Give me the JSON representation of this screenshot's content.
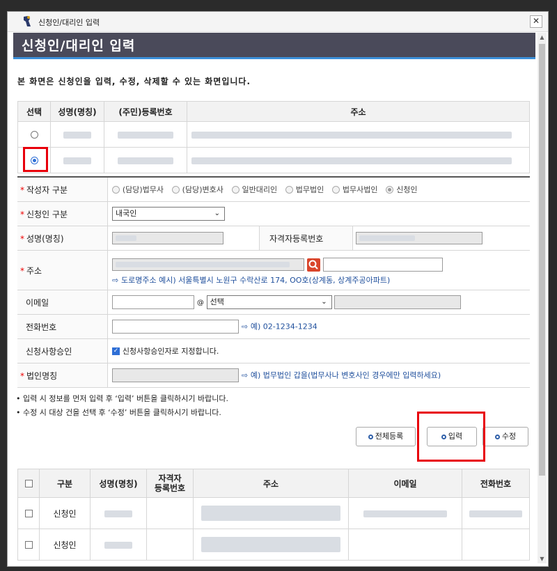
{
  "window": {
    "title": "신청인/대리인 입력"
  },
  "header": {
    "title": "신청인/대리인 입력"
  },
  "description": "본 화면은 신청인을 입력, 수정, 삭제할 수 있는 화면입니다.",
  "top_table": {
    "headers": [
      "선택",
      "성명(명칭)",
      "(주민)등록번호",
      "주소"
    ],
    "selected_row": 1
  },
  "form": {
    "writer_type": {
      "label": "작성자 구분",
      "options": [
        "(담당)법무사",
        "(담당)변호사",
        "일반대리인",
        "법무법인",
        "법무사법인",
        "신청인"
      ],
      "selected": "신청인"
    },
    "applicant_type": {
      "label": "신청인 구분",
      "value": "내국인"
    },
    "name": {
      "label": "성명(명칭)"
    },
    "qualification_no": {
      "label": "자격자등록번호"
    },
    "address": {
      "label": "주소",
      "hint": "도로명주소 예시) 서울특별시 노원구 수락산로 174, OO호(상계동, 상계주공아파트)"
    },
    "email": {
      "label": "이메일",
      "at": "@",
      "domain_select": "선택"
    },
    "phone": {
      "label": "전화번호",
      "hint": "예) 02-1234-1234"
    },
    "approver": {
      "label": "신청사항승인",
      "checkbox_label": "신청사항승인자로 지정합니다."
    },
    "corp_name": {
      "label": "법인명칭",
      "hint": "예) 법무법인 갑을(법무사나 변호사인 경우에만 입력하세요)"
    }
  },
  "notes": [
    "입력 시 정보를 먼저 입력 후 ‘입력’ 버튼을 클릭하시기 바랍니다.",
    "수정 시 대상 건을 선택 후 ‘수정’ 버튼을 클릭하시기 바랍니다."
  ],
  "buttons": {
    "register_all": "전체등록",
    "input": "입력",
    "edit": "수정"
  },
  "bottom_table": {
    "headers": [
      "구분",
      "성명(명칭)",
      "자격자\n등록번호",
      "주소",
      "이메일",
      "전화번호"
    ],
    "header_qual_1": "자격자",
    "header_qual_2": "등록번호",
    "rows": [
      {
        "type": "신청인"
      },
      {
        "type": "신청인"
      }
    ]
  },
  "colors": {
    "header_bg": "#4a4a5a",
    "accent": "#3b8fd9",
    "highlight": "#e8000b"
  }
}
